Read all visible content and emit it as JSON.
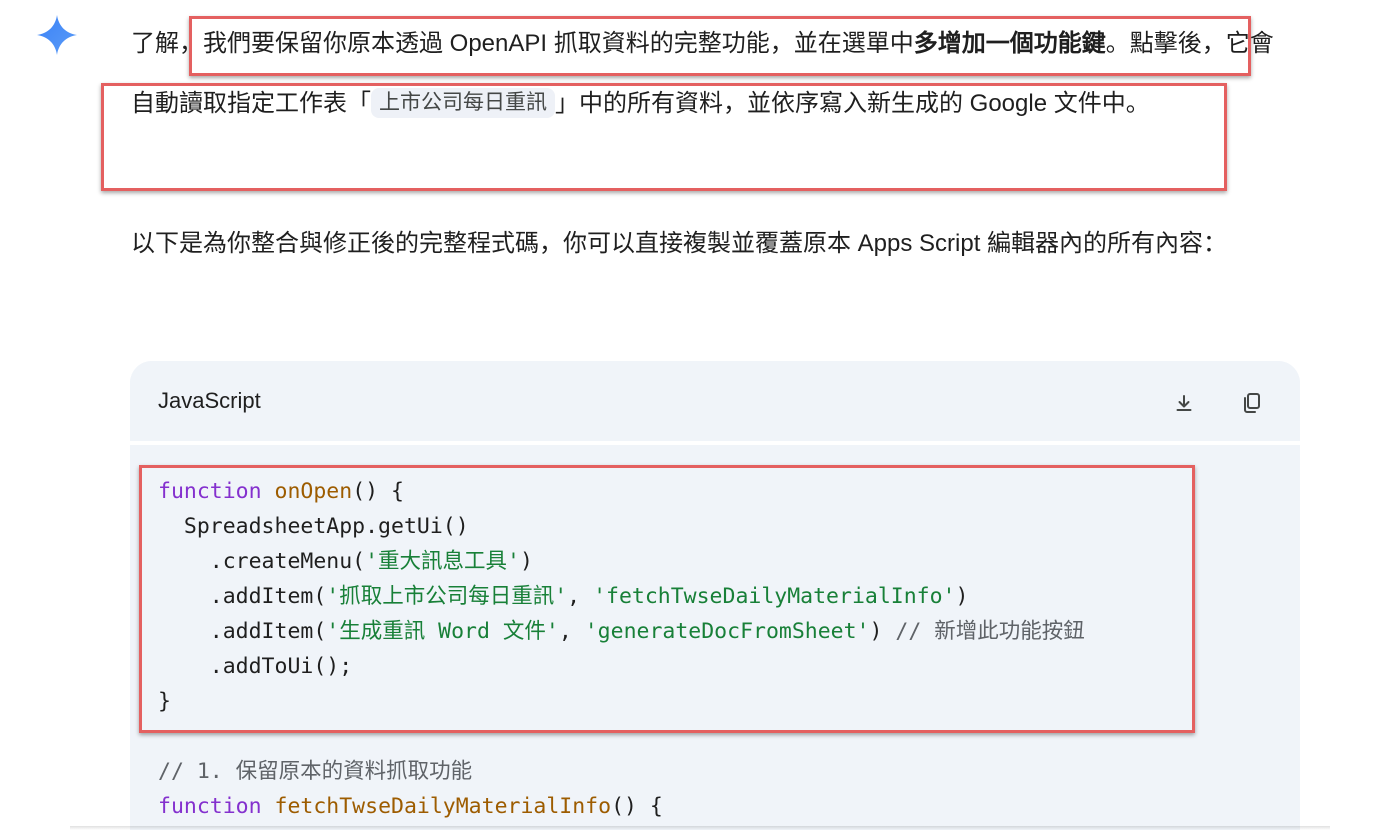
{
  "response": {
    "p1_a": "了解",
    "p1_b": "，我們要保留你原本透過 OpenAPI 抓取資料的完整功能，並在選單中",
    "p1_bold": "多增加一個功能鍵",
    "p1_c": "。點擊後，它會自動讀取指定工作表「",
    "sheet_chip": "上市公司每日重訊",
    "p1_d": "」中的所有資料，並依序寫入新生成的 Google 文件中。",
    "p2": "以下是為你整合與修正後的完整程式碼，你可以直接複製並覆蓋原本 Apps Script 編輯器內的所有內容："
  },
  "code_block": {
    "language": "JavaScript",
    "download_icon": "download-icon",
    "copy_icon": "copy-icon",
    "lines": [
      {
        "kw": "function",
        "fn": "onOpen",
        "rest": "() {"
      },
      {
        "plain": "  SpreadsheetApp.getUi()"
      },
      {
        "pre": "    .createMenu(",
        "s1": "'重大訊息工具'",
        "post": ")"
      },
      {
        "pre": "    .addItem(",
        "s1": "'抓取上市公司每日重訊'",
        "mid": ", ",
        "s2": "'fetchTwseDailyMaterialInfo'",
        "post": ")"
      },
      {
        "pre": "    .addItem(",
        "s1": "'生成重訊 Word 文件'",
        "mid": ", ",
        "s2": "'generateDocFromSheet'",
        "post": ") ",
        "comment": "// 新增此功能按鈕"
      },
      {
        "plain": "    .addToUi();"
      },
      {
        "plain": "}"
      },
      {
        "plain": ""
      },
      {
        "comment": "// 1. 保留原本的資料抓取功能"
      },
      {
        "kw": "function",
        "fn": "fetchTwseDailyMaterialInfo",
        "rest": "() {"
      }
    ]
  },
  "colors": {
    "highlight": "#e46060",
    "gemini_spark": "#4a86f7",
    "code_bg": "#f0f4f9"
  }
}
